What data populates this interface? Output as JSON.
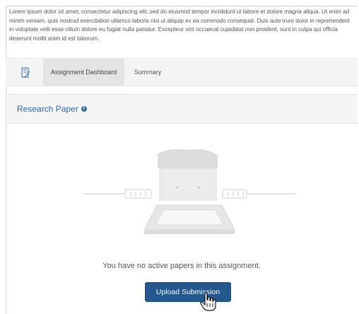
{
  "intro": {
    "text": "Lorem ipsum dolor sit amet, consectetur adipiscing elit, sed do eiusmod tempor incididunt ut labore et dolore magna aliqua. Ut enim ad minim veniam, quis nostrud exercitation ullamco laboris nisi ut aliquip ex ea commodo consequat. Duis aute irure dolor in reprehenderit in voluptate velit esse cillum dolore eu fugiat nulla pariatur. Excepteur sint occaecat cupidatat non proident, sunt in culpa qui officia deserunt mollit anim id est laborum."
  },
  "tabs": {
    "icon": "assignment-icon",
    "items": [
      {
        "label": "Assignment Dashboard",
        "active": true
      },
      {
        "label": "Summary",
        "active": false
      }
    ]
  },
  "paper": {
    "title": "Research Paper",
    "info_icon": "info-icon"
  },
  "empty_state": {
    "illustration": "empty-tray-person-illustration",
    "message": "You have no active papers in this assignment."
  },
  "actions": {
    "upload_label": "Upload Submission"
  },
  "colors": {
    "accent": "#2f6aa5",
    "button": "#23578e",
    "tab_active_bg": "#e4e4e4",
    "header_bg": "#f5f5f5"
  }
}
